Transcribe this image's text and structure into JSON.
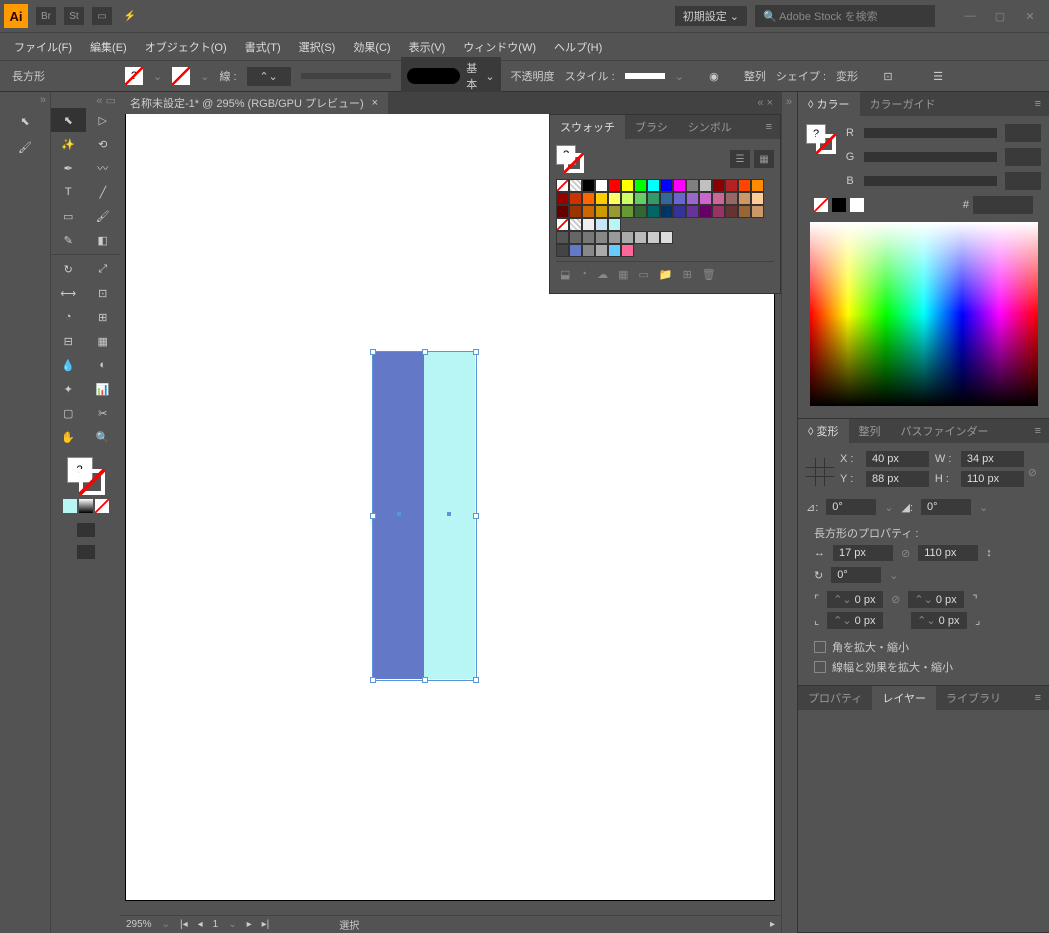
{
  "title": {
    "workspace": "初期設定",
    "search_placeholder": "Adobe Stock を検索"
  },
  "menu": [
    "ファイル(F)",
    "編集(E)",
    "オブジェクト(O)",
    "書式(T)",
    "選択(S)",
    "効果(C)",
    "表示(V)",
    "ウィンドウ(W)",
    "ヘルプ(H)"
  ],
  "control": {
    "object_name": "長方形",
    "stroke_label": "線 :",
    "stroke_weight": "",
    "profile_label": "基本",
    "opacity_label": "不透明度",
    "style_label": "スタイル :",
    "align_label": "整列",
    "shape_label": "シェイプ :",
    "transform_label": "変形"
  },
  "doc_tab": "名称未設定-1* @ 295% (RGB/GPU プレビュー)",
  "status": {
    "zoom": "295%",
    "page": "1",
    "tool": "選択"
  },
  "swatches": {
    "tabs": [
      "スウォッチ",
      "ブラシ",
      "シンボル"
    ],
    "row1": [
      "none",
      "pat1",
      "#000000",
      "#ffffff",
      "#ff0000",
      "#ffff00",
      "#00ff00",
      "#00ffff",
      "#0000ff",
      "#ff00ff",
      "#808080",
      "#c0c0c0",
      "#8b0000",
      "#b22222",
      "#ff4500",
      "#ff8c00"
    ],
    "row2": [
      "#990000",
      "#cc3300",
      "#ff6600",
      "#ffcc00",
      "#ffff66",
      "#ccff66",
      "#66cc66",
      "#339966",
      "#336699",
      "#6666cc",
      "#9966cc",
      "#cc66cc",
      "#cc6699",
      "#996666",
      "#cc9966",
      "#ffcc99"
    ],
    "row3": [
      "#660000",
      "#993300",
      "#cc6600",
      "#cc9900",
      "#999933",
      "#669933",
      "#336633",
      "#006666",
      "#003366",
      "#333399",
      "#663399",
      "#660066",
      "#993366",
      "#663333",
      "#996633",
      "#cc9966"
    ],
    "row4": [
      "none",
      "pat2",
      "#eeeeee",
      "#c8e6f5",
      "#b8f5f5",
      "",
      "",
      "",
      "",
      "",
      "",
      "",
      "",
      "",
      "",
      ""
    ],
    "row5": [
      "#555555",
      "#666666",
      "#777777",
      "#888888",
      "#999999",
      "#aaaaaa",
      "#bbbbbb",
      "#cccccc",
      "#dddddd",
      "",
      "",
      "",
      "",
      "",
      "",
      ""
    ],
    "row6": [
      "#444444",
      "#6478c8",
      "#888888",
      "#aaaaaa",
      "#66ccff",
      "#ff6699",
      "",
      "",
      "",
      "",
      "",
      "",
      "",
      "",
      "",
      ""
    ]
  },
  "color_panel": {
    "tabs": [
      "カラー",
      "カラーガイド"
    ],
    "channels": [
      "R",
      "G",
      "B"
    ],
    "hex_prefix": "#"
  },
  "transform_panel": {
    "tabs": [
      "変形",
      "整列",
      "パスファインダー"
    ],
    "x_label": "X :",
    "x_val": "40 px",
    "y_label": "Y :",
    "y_val": "88 px",
    "w_label": "W :",
    "w_val": "34 px",
    "h_label": "H :",
    "h_val": "110 px",
    "rot_val": "0°",
    "shear_val": "0°",
    "rect_prop_title": "長方形のプロパティ :",
    "rect_w": "17 px",
    "rect_h": "110 px",
    "rect_rot": "0°",
    "corner": "0 px",
    "scale_corners": "角を拡大・縮小",
    "scale_strokes": "線幅と効果を拡大・縮小"
  },
  "bottom_tabs": [
    "プロパティ",
    "レイヤー",
    "ライブラリ"
  ]
}
